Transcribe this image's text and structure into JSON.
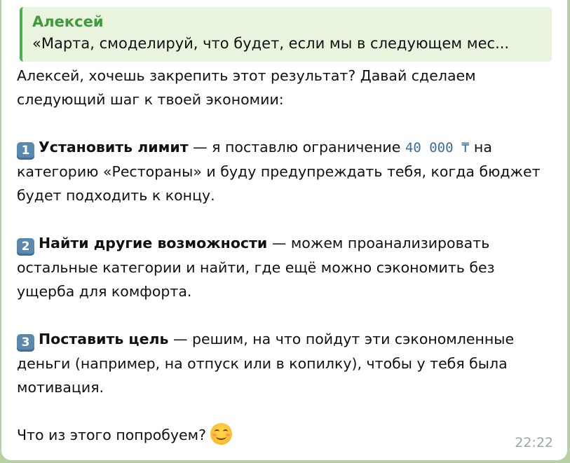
{
  "reply": {
    "author": "Алексей",
    "text": "«Марта, смоделируй, что будет, если мы в следующем мес..."
  },
  "message": {
    "intro": "Алексей, хочешь закрепить этот результат? Давай сделаем следующий шаг к твоей экономии:",
    "items": [
      {
        "number": "1",
        "title": "Установить лимит",
        "text_before": " — я поставлю ограничение ",
        "amount": "40 000 ₸",
        "text_after": " на категорию «Рестораны» и буду предупреждать тебя, когда бюджет будет подходить к концу."
      },
      {
        "number": "2",
        "title": "Найти другие возможности",
        "text": " — можем проанализировать остальные категории и найти, где ещё можно сэкономить без ущерба для комфорта."
      },
      {
        "number": "3",
        "title": "Поставить цель",
        "text": " — решим, на что пойдут эти сэкономленные деньги (например, на отпуск или в копилку), чтобы у тебя была мотивация."
      }
    ],
    "outro": "Что из этого попробуем?",
    "emoji": "smiling-face-icon",
    "time": "22:22"
  }
}
